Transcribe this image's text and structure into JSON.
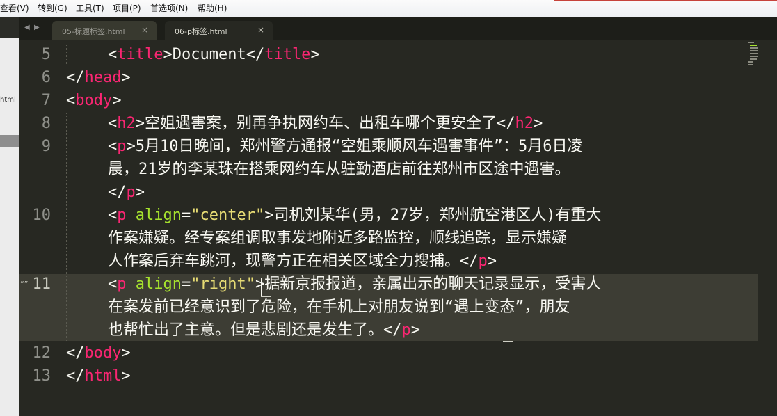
{
  "menubar": {
    "items": [
      "查看(V)",
      "转到(G)",
      "工具(T)",
      "项目(P)",
      "首选项(N)",
      "帮助(H)"
    ]
  },
  "sidebar": {
    "partial_label": "html"
  },
  "tabs": [
    {
      "label": "05-标题标签.html",
      "close": "×",
      "active": false
    },
    {
      "label": "06-p标签.html",
      "close": "×",
      "active": true
    }
  ],
  "nav": {
    "back": "◀",
    "forward": "▶"
  },
  "editor": {
    "line_numbers": [
      "5",
      "6",
      "7",
      "8",
      "9",
      "10",
      "11",
      "12",
      "13"
    ],
    "modified_marker": "“”",
    "lines": {
      "l5_text": "Document",
      "l5_tag": "title",
      "l6_tag": "head",
      "l7_tag": "body",
      "l8_tag": "h2",
      "l8_text": "空姐遇害案，别再争执网约车、出租车哪个更安全了",
      "l9_tag": "p",
      "l9_text_1": "5月10日晚间，郑州警方通报“空姐乘顺风车遇害事件”：5月6日凌",
      "l9_text_2": "晨，21岁的李某珠在搭乘网约车从驻勤酒店前往郑州市区途中遇害。",
      "l10_tag": "p",
      "l10_attr": "align",
      "l10_val": "\"center\"",
      "l10_text_1": "司机刘某华(男，27岁，郑州航空港区人)有重大",
      "l10_text_2": "作案嫌疑。经专案组调取事发地附近多路监控，顺线追踪，显示嫌疑",
      "l10_text_3": "人作案后弃车跳河，现警方正在相关区域全力搜捕。",
      "l11_tag": "p",
      "l11_attr": "align",
      "l11_val": "\"right\"",
      "l11_text_1": "据新京报报道，亲属出示的聊天记录显示，受害人",
      "l11_text_2": "在案发前已经意识到了危险，在手机上对朋友说到“遇上变态”，朋友",
      "l11_text_3": "也帮忙出了主意。但是悲剧还是发生了。",
      "l12_tag": "body",
      "l13_tag": "html"
    }
  },
  "colors": {
    "background": "#272822",
    "tag": "#f92672",
    "attribute": "#a6e22e",
    "string": "#e6db74",
    "text": "#f8f8f2",
    "line_number": "#8f908a"
  }
}
